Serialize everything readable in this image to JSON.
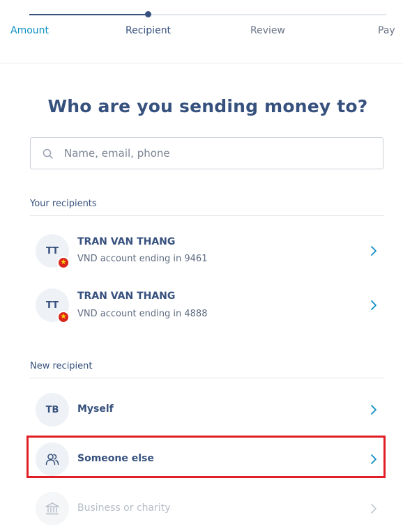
{
  "stepper": {
    "steps": [
      {
        "label": "Amount",
        "state": "done"
      },
      {
        "label": "Recipient",
        "state": "current"
      },
      {
        "label": "Review",
        "state": "upcoming"
      },
      {
        "label": "Pay",
        "state": "upcoming"
      }
    ],
    "progress_color": "#37517e",
    "done_color": "#0e8fc4"
  },
  "page": {
    "title": "Who are you sending money to?"
  },
  "search": {
    "placeholder": "Name, email, phone",
    "value": "",
    "icon": "search-icon"
  },
  "your_recipients": {
    "header": "Your recipients",
    "items": [
      {
        "initials": "TT",
        "name": "TRAN VAN THANG",
        "detail": "VND account ending in 9461",
        "flag": "vietnam-flag-icon",
        "flag_glyph": "★"
      },
      {
        "initials": "TT",
        "name": "TRAN VAN THANG",
        "detail": "VND account ending in 4888",
        "flag": "vietnam-flag-icon",
        "flag_glyph": "★"
      }
    ]
  },
  "new_recipient": {
    "header": "New recipient",
    "items": [
      {
        "initials": "TB",
        "label": "Myself"
      },
      {
        "icon": "people-icon",
        "label": "Someone else",
        "highlighted": true
      },
      {
        "icon": "bank-icon",
        "label": "Business or charity",
        "disabled": true
      }
    ]
  },
  "colors": {
    "brand_navy": "#37517e",
    "link_blue": "#0e8fc4",
    "highlight_red": "#e01e26",
    "flag_red": "#da251d",
    "flag_star": "#ffdd00"
  }
}
